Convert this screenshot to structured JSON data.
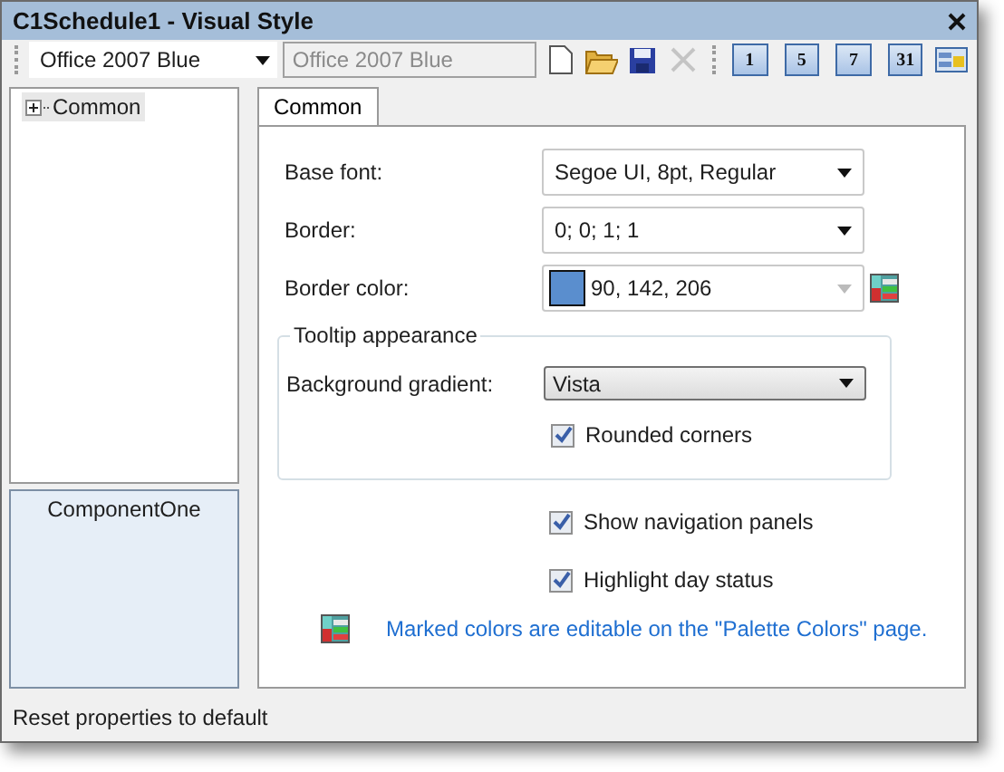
{
  "window": {
    "title": "C1Schedule1 - Visual Style"
  },
  "toolbar": {
    "style_select": {
      "value": "Office 2007 Blue"
    },
    "name_field": {
      "value": "Office 2007 Blue",
      "disabled": true
    },
    "file_buttons": [
      {
        "kind": "new",
        "disabled": false
      },
      {
        "kind": "open",
        "disabled": false
      },
      {
        "kind": "save",
        "disabled": false
      },
      {
        "kind": "delete",
        "disabled": true
      }
    ],
    "view_buttons": [
      {
        "kind": "calendar",
        "label": "1"
      },
      {
        "kind": "calendar",
        "label": "5"
      },
      {
        "kind": "calendar",
        "label": "7"
      },
      {
        "kind": "calendar",
        "label": "31"
      },
      {
        "kind": "palette"
      }
    ]
  },
  "tree": {
    "items": [
      {
        "label": "Common",
        "expanded": false,
        "selected": true
      }
    ]
  },
  "preview": {
    "label": "ComponentOne"
  },
  "tabs": [
    {
      "label": "Common",
      "selected": true
    }
  ],
  "fields": [
    {
      "kind": "dropdown",
      "label": "Base font:",
      "value": "Segoe UI, 8pt, Regular"
    },
    {
      "kind": "dropdown",
      "label": "Border:",
      "value": "0; 0; 1; 1"
    },
    {
      "kind": "color",
      "label": "Border color:",
      "value": "90, 142, 206",
      "color": "#5a8ece"
    }
  ],
  "tooltip_group": {
    "title": "Tooltip appearance",
    "gradient": {
      "label": "Background gradient:",
      "value": "Vista"
    },
    "rounded_corners": {
      "label": "Rounded corners",
      "checked": true
    }
  },
  "options": [
    {
      "label": "Show navigation panels",
      "checked": true
    },
    {
      "label": "Highlight day status",
      "checked": true
    }
  ],
  "note": "Marked colors are editable on the \"Palette Colors\" page.",
  "status_bar": "Reset properties to default"
}
